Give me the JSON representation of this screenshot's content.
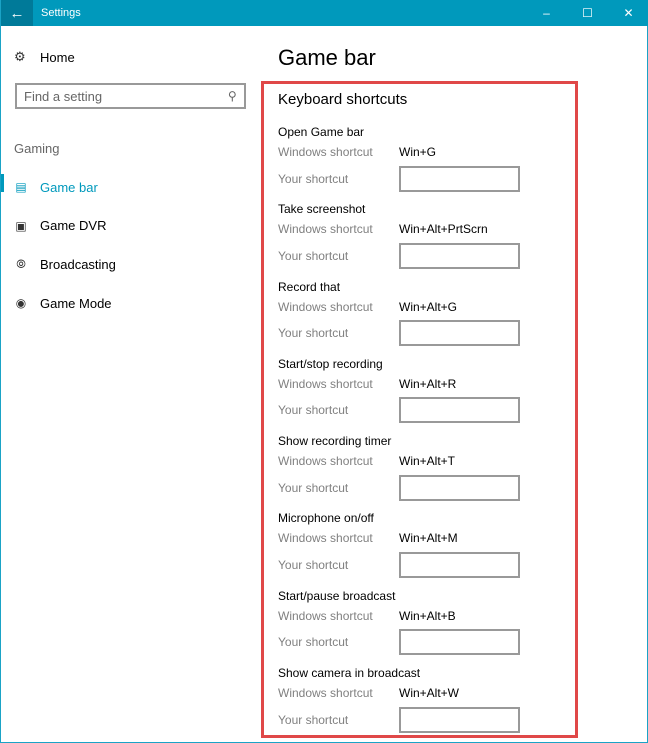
{
  "window": {
    "title": "Settings",
    "back_icon": "arrow-left-icon",
    "controls": {
      "minimize": "–",
      "maximize": "☐",
      "close": "✕"
    }
  },
  "sidebar": {
    "home_label": "Home",
    "search_placeholder": "Find a setting",
    "group_label": "Gaming",
    "items": [
      {
        "label": "Game bar",
        "icon": "game-bar-icon",
        "active": true
      },
      {
        "label": "Game DVR",
        "icon": "game-dvr-icon",
        "active": false
      },
      {
        "label": "Broadcasting",
        "icon": "broadcasting-icon",
        "active": false
      },
      {
        "label": "Game Mode",
        "icon": "game-mode-icon",
        "active": false
      }
    ]
  },
  "main": {
    "page_title": "Game bar",
    "section_title": "Keyboard shortcuts",
    "windows_shortcut_label": "Windows shortcut",
    "your_shortcut_label": "Your shortcut",
    "shortcuts": [
      {
        "name": "Open Game bar",
        "windows": "Win+G",
        "yours": ""
      },
      {
        "name": "Take screenshot",
        "windows": "Win+Alt+PrtScrn",
        "yours": ""
      },
      {
        "name": "Record that",
        "windows": "Win+Alt+G",
        "yours": ""
      },
      {
        "name": "Start/stop recording",
        "windows": "Win+Alt+R",
        "yours": ""
      },
      {
        "name": "Show recording timer",
        "windows": "Win+Alt+T",
        "yours": ""
      },
      {
        "name": "Microphone on/off",
        "windows": "Win+Alt+M",
        "yours": ""
      },
      {
        "name": "Start/pause broadcast",
        "windows": "Win+Alt+B",
        "yours": ""
      },
      {
        "name": "Show camera in broadcast",
        "windows": "Win+Alt+W",
        "yours": ""
      }
    ]
  },
  "colors": {
    "accent": "#0099bc",
    "highlight_border": "#e04848"
  }
}
